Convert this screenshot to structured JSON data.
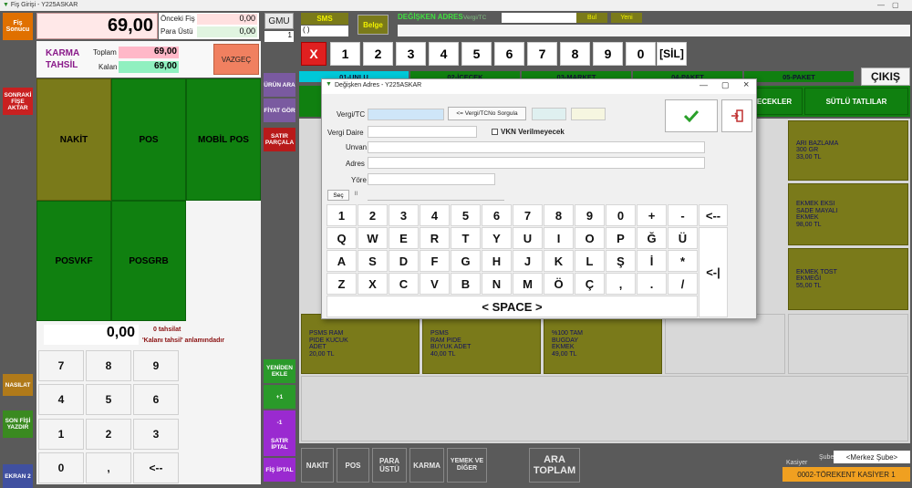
{
  "window": {
    "title": "Fiş Girişi - Y225ASKAR"
  },
  "left_panel": {
    "fis_sonucu": "Fiş Sonucu",
    "sonraki_fise_aktar": "SONRAKİ FİŞE AKTAR",
    "nasil": "NASILAT",
    "son_fisi_yazdir": "SON FİŞİ YAZDIR",
    "ekran2": "EKRAN 2"
  },
  "totals": {
    "main_total": "69,00",
    "onceki_fis_label": "Önceki Fiş",
    "onceki_fis_value": "0,00",
    "para_ustu_label": "Para Üstü",
    "para_ustu_value": "0,00",
    "karma_tahsil": "KARMA TAHSİL",
    "toplam_label": "Toplam",
    "toplam_value": "69,00",
    "kalan_label": "Kalan",
    "kalan_value": "69,00",
    "vazgec": "VAZGEÇ"
  },
  "payment_buttons": [
    "NAKİT",
    "POS",
    "MOBİL POS",
    "POSVKF",
    "POSGRB"
  ],
  "tahsilat": {
    "amount": "0,00",
    "info1": "0 tahsilat",
    "info2": "'Kalanı tahsil' anlamındadır"
  },
  "numpad": [
    "7",
    "8",
    "9",
    "4",
    "5",
    "6",
    "1",
    "2",
    "3",
    "0",
    ",",
    "<--"
  ],
  "middle_col": {
    "gmu": "GMU",
    "gmu_value": "1",
    "urun_ara": "ÜRÜN ARA",
    "fiyat_gor": "FİYAT GÖR",
    "satir_parcala": "SATIR PARÇALA",
    "yeniden_ekle": "YENİDEN EKLE",
    "plus1": "+1",
    "minus1": "-1",
    "satir_iptal": "SATIR İPTAL",
    "fis_iptal": "FİŞ İPTAL"
  },
  "top_bar": {
    "sms": "SMS",
    "parens": "( )",
    "belge": "Belge",
    "degisken_adres": "DEĞİŞKEN ADRES",
    "vergi_tc": "Vergi/TC",
    "bul": "Bul",
    "yeni": "Yeni"
  },
  "keypad_row": {
    "x": "X",
    "digits": [
      "1",
      "2",
      "3",
      "4",
      "5",
      "6",
      "7",
      "8",
      "9",
      "0"
    ],
    "sil": "[SİL]"
  },
  "category_tabs": [
    "01-UNLU",
    "02-İÇECEK",
    "03-MARKET",
    "04-PAKET",
    "05-PAKET"
  ],
  "cikis": "ÇIKIŞ",
  "subcats": {
    "icecekler": "İÇECEKLER",
    "sutlu_tatlilar": "SÜTLÜ TATLILAR"
  },
  "products": {
    "right1": [
      "ARI BAZLAMA",
      "300 GR",
      "33,00 TL"
    ],
    "right2": [
      "EKMEK EKSI",
      "SADE MAYALI",
      "EKMEK",
      "98,00 TL"
    ],
    "right3": [
      "EKMEK TOST",
      "EKMEĞİ",
      "55,00 TL"
    ],
    "row4a": [
      "PSMS RAM",
      "PIDE KUCUK",
      "ADET",
      "20,00 TL"
    ],
    "row4b": [
      "PSMS",
      "RAM PIDE",
      "BUYUK ADET",
      "40,00 TL"
    ],
    "row4c": [
      "%100 TAM",
      "BUGDAY",
      "EKMEK",
      "49,00 TL"
    ]
  },
  "bottom_bar": {
    "nakit": "NAKİT",
    "pos": "POS",
    "para_ustu": "PARA ÜSTÜ",
    "karma": "KARMA",
    "yemek_ve_diger": "YEMEK VE DİĞER",
    "ara_toplam": "ARA TOPLAM",
    "kasiyer_label": "Kasiyer",
    "sube_label": "Şube",
    "sube_value": "<Merkez Şube>",
    "kasiyer_value": "0002-TÖREKENT KASİYER 1"
  },
  "dialog": {
    "title": "Değişken Adres - Y225ASKAR",
    "vergi_tc_label": "Vergi/TC",
    "sorgula": "<= Vergi/TCNo Sorgula",
    "vergi_daire_label": "Vergi Daire",
    "vkn_label": "VKN Verilmeyecek",
    "unvan_label": "Unvan",
    "adres_label": "Adres",
    "yore_label": "Yöre",
    "sec": "Seç",
    "sec_value": "ll",
    "keys_row1": [
      "1",
      "2",
      "3",
      "4",
      "5",
      "6",
      "7",
      "8",
      "9",
      "0",
      "+",
      "-",
      "<--"
    ],
    "keys_row2": [
      "Q",
      "W",
      "E",
      "R",
      "T",
      "Y",
      "U",
      "I",
      "O",
      "P",
      "Ğ",
      "Ü"
    ],
    "keys_row3": [
      "A",
      "S",
      "D",
      "F",
      "G",
      "H",
      "J",
      "K",
      "L",
      "Ş",
      "İ",
      "*"
    ],
    "keys_row4": [
      "Z",
      "X",
      "C",
      "V",
      "B",
      "N",
      "M",
      "Ö",
      "Ç",
      ",",
      ".",
      "/"
    ],
    "enter": "<-|",
    "space": "< SPACE >"
  },
  "colors": {
    "olive": "#7a7a1a",
    "green": "#108010",
    "cyan_tab": "#00c8d8",
    "dialog_bg": "#f0f0f0"
  }
}
